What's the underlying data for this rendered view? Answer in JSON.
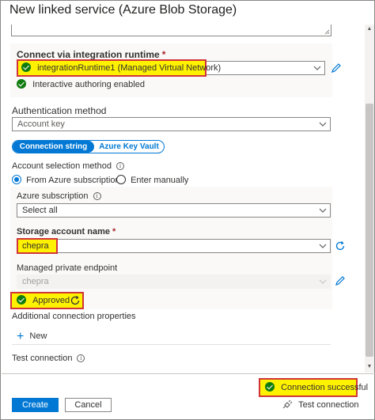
{
  "window": {
    "title": "New linked service (Azure Blob Storage)"
  },
  "runtime": {
    "label": "Connect via integration runtime",
    "required_mark": "*",
    "value": "integrationRuntime1 (Managed Virtual Network)",
    "status_text": "Interactive authoring enabled"
  },
  "auth": {
    "label": "Authentication method",
    "value": "Account key"
  },
  "connection_tabs": {
    "active": "Connection string",
    "inactive": "Azure Key Vault"
  },
  "account_selection": {
    "label": "Account selection method",
    "options": [
      "From Azure subscription",
      "Enter manually"
    ],
    "selected": "From Azure subscription"
  },
  "subscription": {
    "label": "Azure subscription",
    "value": "Select all"
  },
  "storage_account": {
    "label": "Storage account name",
    "required_mark": "*",
    "value": "chepra"
  },
  "private_endpoint": {
    "label": "Managed private endpoint",
    "value": "chepra",
    "status": "Approved"
  },
  "additional_properties": {
    "label": "Additional connection properties",
    "new_label": "New"
  },
  "test_connection": {
    "label": "Test connection"
  },
  "footer": {
    "status": "Connection successful",
    "create_label": "Create",
    "cancel_label": "Cancel",
    "test_label": "Test connection"
  },
  "colors": {
    "accent": "#0078d4",
    "success": "#107c10",
    "highlight_fill": "#fff200",
    "highlight_border": "#d13438"
  }
}
